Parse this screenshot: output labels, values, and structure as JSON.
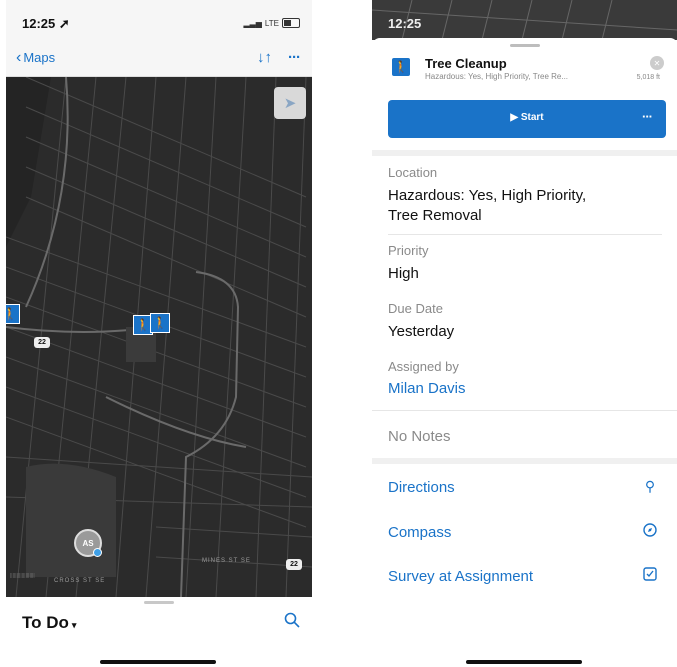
{
  "left": {
    "status": {
      "time": "12:25 ➚",
      "network": "LTE"
    },
    "nav": {
      "back_label": "Maps",
      "sort_glyph": "↓↑",
      "more_glyph": "···"
    },
    "map": {
      "avatar_initials": "AS",
      "road_shield_label": "22",
      "road_shield_label_2": "22",
      "street_labels": [
        "CROSS ST SE",
        "MINES ST SE"
      ]
    },
    "bottom_sheet": {
      "title": "To Do",
      "caret": "▾"
    }
  },
  "right": {
    "status": {
      "time": "12:25"
    },
    "header": {
      "title": "Tree Cleanup",
      "subtitle": "Hazardous: Yes, High Priority, Tree Re...",
      "distance": "5,018 ft"
    },
    "start_button": {
      "label": "▶ Start",
      "more": "···"
    },
    "fields": {
      "location_label": "Location",
      "location_value_line1": "Hazardous: Yes, High Priority,",
      "location_value_line2": "Tree Removal",
      "priority_label": "Priority",
      "priority_value": "High",
      "due_label": "Due Date",
      "due_value": "Yesterday",
      "assigned_label": "Assigned by",
      "assigned_value": "Milan Davis"
    },
    "notes": "No Notes",
    "actions": [
      {
        "label": "Directions",
        "icon": "map-pin-icon"
      },
      {
        "label": "Compass",
        "icon": "compass-icon"
      },
      {
        "label": "Survey at Assignment",
        "icon": "survey-icon"
      }
    ]
  },
  "colors": {
    "accent": "#1a73c8",
    "map_bg": "#2b2b2b"
  }
}
